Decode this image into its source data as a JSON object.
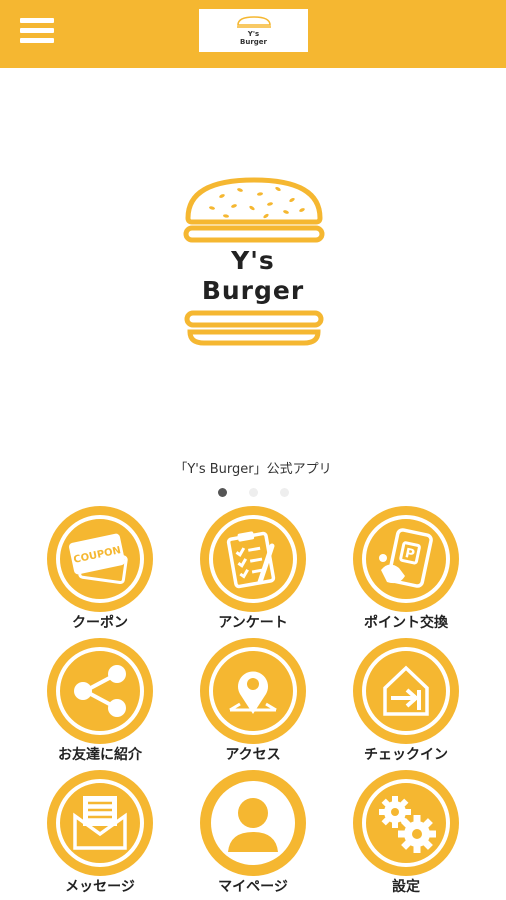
{
  "header": {
    "logo_line1": "Y's",
    "logo_line2": "Burger"
  },
  "hero": {
    "logo_line1": "Y's",
    "logo_line2": "Burger",
    "caption": "「Y's Burger」公式アプリ",
    "slide_count": 3,
    "active_slide": 1
  },
  "colors": {
    "accent": "#F5B731",
    "icon_fg": "#ffffff",
    "text": "#222222"
  },
  "menu": [
    {
      "label": "クーポン",
      "icon": "coupon-icon",
      "badge": "COUPON"
    },
    {
      "label": "アンケート",
      "icon": "clipboard-icon"
    },
    {
      "label": "ポイント交換",
      "icon": "point-exchange-icon",
      "badge": "P"
    },
    {
      "label": "お友達に紹介",
      "icon": "share-icon"
    },
    {
      "label": "アクセス",
      "icon": "map-pin-icon"
    },
    {
      "label": "チェックイン",
      "icon": "checkin-icon"
    },
    {
      "label": "メッセージ",
      "icon": "message-icon"
    },
    {
      "label": "マイページ",
      "icon": "user-icon"
    },
    {
      "label": "設定",
      "icon": "gear-icon"
    }
  ]
}
